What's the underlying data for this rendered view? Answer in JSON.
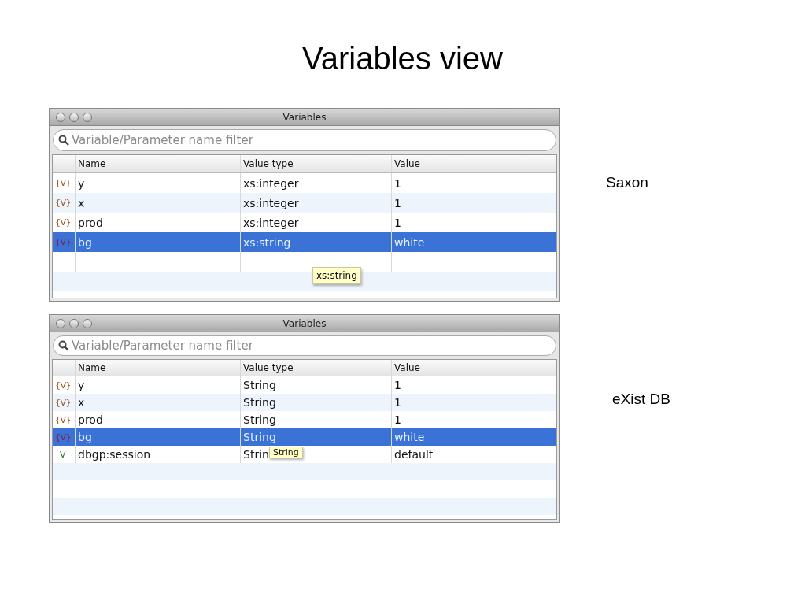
{
  "slide_title": "Variables view",
  "panels": [
    {
      "caption": "Saxon",
      "window": {
        "title": "Variables"
      },
      "search": {
        "placeholder": "Variable/Parameter name filter"
      },
      "columns": [
        "Name",
        "Value type",
        "Value"
      ],
      "rows": [
        {
          "kind": "variable",
          "icon": "{V}",
          "name": "y",
          "type": "xs:integer",
          "value": "1",
          "selected": false
        },
        {
          "kind": "variable",
          "icon": "{V}",
          "name": "x",
          "type": "xs:integer",
          "value": "1",
          "selected": false
        },
        {
          "kind": "variable",
          "icon": "{V}",
          "name": "prod",
          "type": "xs:integer",
          "value": "1",
          "selected": false
        },
        {
          "kind": "variable",
          "icon": "{V}",
          "name": "bg",
          "type": "xs:string",
          "value": "white",
          "selected": true
        },
        {
          "kind": "empty",
          "selected": false,
          "tooltip": "xs:string"
        }
      ]
    },
    {
      "caption": "eXist DB",
      "window": {
        "title": "Variables"
      },
      "search": {
        "placeholder": "Variable/Parameter name filter"
      },
      "columns": [
        "Name",
        "Value type",
        "Value"
      ],
      "rows": [
        {
          "kind": "variable",
          "icon": "{V}",
          "name": "y",
          "type": "String",
          "value": "1",
          "selected": false
        },
        {
          "kind": "variable",
          "icon": "{V}",
          "name": "x",
          "type": "String",
          "value": "1",
          "selected": false
        },
        {
          "kind": "variable",
          "icon": "{V}",
          "name": "prod",
          "type": "String",
          "value": "1",
          "selected": false
        },
        {
          "kind": "variable",
          "icon": "{V}",
          "name": "bg",
          "type": "String",
          "value": "white",
          "selected": true
        },
        {
          "kind": "parameter",
          "icon": "V",
          "name": "dbgp:session",
          "type": "Strin",
          "value": "default",
          "selected": false,
          "tooltip": "String"
        }
      ]
    }
  ]
}
